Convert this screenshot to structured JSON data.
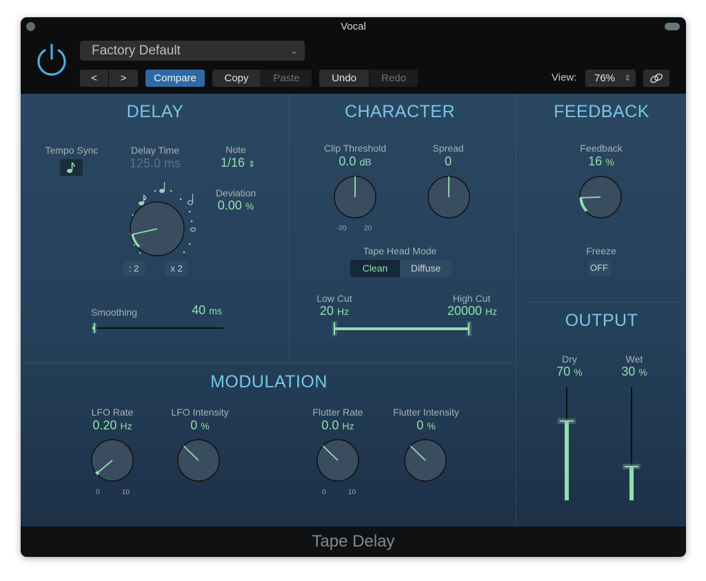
{
  "window": {
    "title": "Vocal",
    "footer_title": "Tape Delay"
  },
  "header": {
    "power_icon": "power-icon",
    "preset": "Factory Default",
    "prev_label": "<",
    "next_label": ">",
    "compare_label": "Compare",
    "copy_label": "Copy",
    "paste_label": "Paste",
    "undo_label": "Undo",
    "redo_label": "Redo",
    "view_label": "View:",
    "view_value": "76%",
    "link_icon": "link-icon"
  },
  "delay": {
    "title": "DELAY",
    "tempo_sync_label": "Tempo Sync",
    "tempo_sync_icon": "eighth-note-icon",
    "delay_time_label": "Delay Time",
    "delay_time_value": "125.0 ms",
    "note_label": "Note",
    "note_value": "1/16",
    "deviation_label": "Deviation",
    "deviation_value": "0.00",
    "deviation_unit": "%",
    "knob_fraction": 0.12,
    "halve_label": ": 2",
    "double_label": "x 2",
    "smoothing_label": "Smoothing",
    "smoothing_value": "40",
    "smoothing_unit": "ms",
    "smoothing_fraction": 0.0
  },
  "character": {
    "title": "CHARACTER",
    "clip_label": "Clip Threshold",
    "clip_value": "0.0",
    "clip_unit": "dB",
    "clip_min": "-20",
    "clip_max": "20",
    "clip_fraction": 0.5,
    "spread_label": "Spread",
    "spread_value": "0",
    "spread_fraction": 0.5,
    "tape_head_label": "Tape Head Mode",
    "tape_head_options": [
      "Clean",
      "Diffuse"
    ],
    "tape_head_selected": "Clean",
    "low_cut_label": "Low Cut",
    "low_cut_value": "20",
    "low_cut_unit": "Hz",
    "high_cut_label": "High Cut",
    "high_cut_value": "20000",
    "high_cut_unit": "Hz"
  },
  "feedback": {
    "title": "FEEDBACK",
    "feedback_label": "Feedback",
    "feedback_value": "16",
    "feedback_unit": "%",
    "feedback_fraction": 0.16,
    "freeze_label": "Freeze",
    "freeze_value": "OFF"
  },
  "output": {
    "title": "OUTPUT",
    "dry_label": "Dry",
    "dry_value": "70",
    "dry_fraction": 0.7,
    "wet_label": "Wet",
    "wet_value": "30",
    "wet_fraction": 0.3,
    "unit": "%"
  },
  "modulation": {
    "title": "MODULATION",
    "lfo_rate_label": "LFO Rate",
    "lfo_rate_value": "0.20",
    "lfo_rate_unit": "Hz",
    "lfo_rate_fraction": 0.02,
    "lfo_rate_min": "0",
    "lfo_rate_max": "10",
    "lfo_intensity_label": "LFO Intensity",
    "lfo_intensity_value": "0",
    "lfo_intensity_unit": "%",
    "lfo_intensity_fraction": 0.33,
    "flutter_rate_label": "Flutter Rate",
    "flutter_rate_value": "0.0",
    "flutter_rate_unit": "Hz",
    "flutter_rate_fraction": 0.33,
    "flutter_rate_min": "0",
    "flutter_rate_max": "10",
    "flutter_intensity_label": "Flutter Intensity",
    "flutter_intensity_value": "0",
    "flutter_intensity_unit": "%",
    "flutter_intensity_fraction": 0.33
  }
}
